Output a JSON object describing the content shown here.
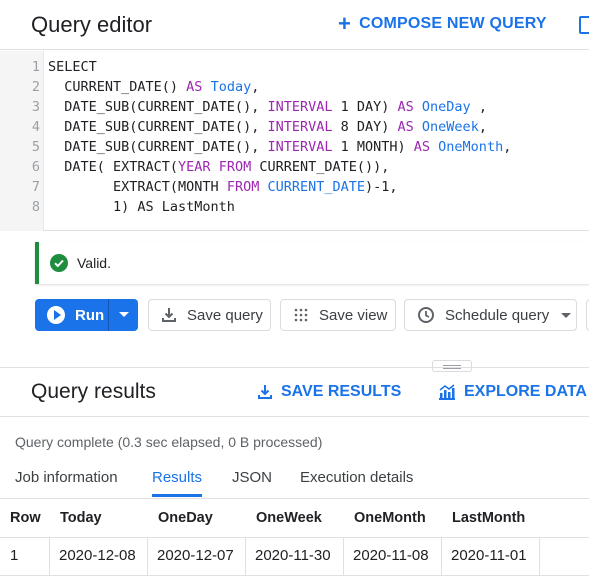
{
  "editor_header": {
    "title": "Query editor",
    "compose_label": "COMPOSE NEW QUERY"
  },
  "code": {
    "line_numbers": [
      "1",
      "2",
      "3",
      "4",
      "5",
      "6",
      "7",
      "8"
    ],
    "lines": [
      [
        {
          "t": "SELECT",
          "c": "pl"
        }
      ],
      [
        {
          "t": "  CURRENT_DATE() ",
          "c": "pl"
        },
        {
          "t": "AS",
          "c": "kw"
        },
        {
          "t": " ",
          "c": "pl"
        },
        {
          "t": "Today",
          "c": "fn"
        },
        {
          "t": ",",
          "c": "pl"
        }
      ],
      [
        {
          "t": "  DATE_SUB(CURRENT_DATE(), ",
          "c": "pl"
        },
        {
          "t": "INTERVAL",
          "c": "kw"
        },
        {
          "t": " 1 DAY) ",
          "c": "pl"
        },
        {
          "t": "AS",
          "c": "kw"
        },
        {
          "t": " ",
          "c": "pl"
        },
        {
          "t": "OneDay",
          "c": "fn"
        },
        {
          "t": " ,",
          "c": "pl"
        }
      ],
      [
        {
          "t": "  DATE_SUB(CURRENT_DATE(), ",
          "c": "pl"
        },
        {
          "t": "INTERVAL",
          "c": "kw"
        },
        {
          "t": " 8 DAY) ",
          "c": "pl"
        },
        {
          "t": "AS",
          "c": "kw"
        },
        {
          "t": " ",
          "c": "pl"
        },
        {
          "t": "OneWeek",
          "c": "fn"
        },
        {
          "t": ",",
          "c": "pl"
        }
      ],
      [
        {
          "t": "  DATE_SUB(CURRENT_DATE(), ",
          "c": "pl"
        },
        {
          "t": "INTERVAL",
          "c": "kw"
        },
        {
          "t": " 1 MONTH) ",
          "c": "pl"
        },
        {
          "t": "AS",
          "c": "kw"
        },
        {
          "t": " ",
          "c": "pl"
        },
        {
          "t": "OneMonth",
          "c": "fn"
        },
        {
          "t": ",",
          "c": "pl"
        }
      ],
      [
        {
          "t": "  DATE( EXTRACT(",
          "c": "pl"
        },
        {
          "t": "YEAR",
          "c": "kw"
        },
        {
          "t": " ",
          "c": "pl"
        },
        {
          "t": "FROM",
          "c": "kw"
        },
        {
          "t": " CURRENT_DATE()),",
          "c": "pl"
        }
      ],
      [
        {
          "t": "        EXTRACT(MONTH ",
          "c": "pl"
        },
        {
          "t": "FROM",
          "c": "kw"
        },
        {
          "t": " ",
          "c": "pl"
        },
        {
          "t": "CURRENT_DATE",
          "c": "fn"
        },
        {
          "t": ")-1,",
          "c": "pl"
        }
      ],
      [
        {
          "t": "        1) AS LastMonth",
          "c": "pl"
        }
      ]
    ]
  },
  "validation": {
    "message": "Valid.",
    "color": "#1e8e3e"
  },
  "toolbar": {
    "run_label": "Run",
    "save_query_label": "Save query",
    "save_view_label": "Save view",
    "schedule_label": "Schedule query"
  },
  "results_header": {
    "title": "Query results",
    "save_results_label": "SAVE RESULTS",
    "explore_data_label": "EXPLORE DATA"
  },
  "status_text": "Query complete (0.3 sec elapsed, 0 B processed)",
  "tabs": [
    "Job information",
    "Results",
    "JSON",
    "Execution details"
  ],
  "active_tab": "Results",
  "table": {
    "columns": [
      "Row",
      "Today",
      "OneDay",
      "OneWeek",
      "OneMonth",
      "LastMonth"
    ],
    "rows": [
      [
        "1",
        "2020-12-08",
        "2020-12-07",
        "2020-11-30",
        "2020-11-08",
        "2020-11-01"
      ]
    ]
  },
  "colors": {
    "accent": "#1a73e8",
    "keyword": "#9c27b0",
    "success": "#1e8e3e"
  }
}
